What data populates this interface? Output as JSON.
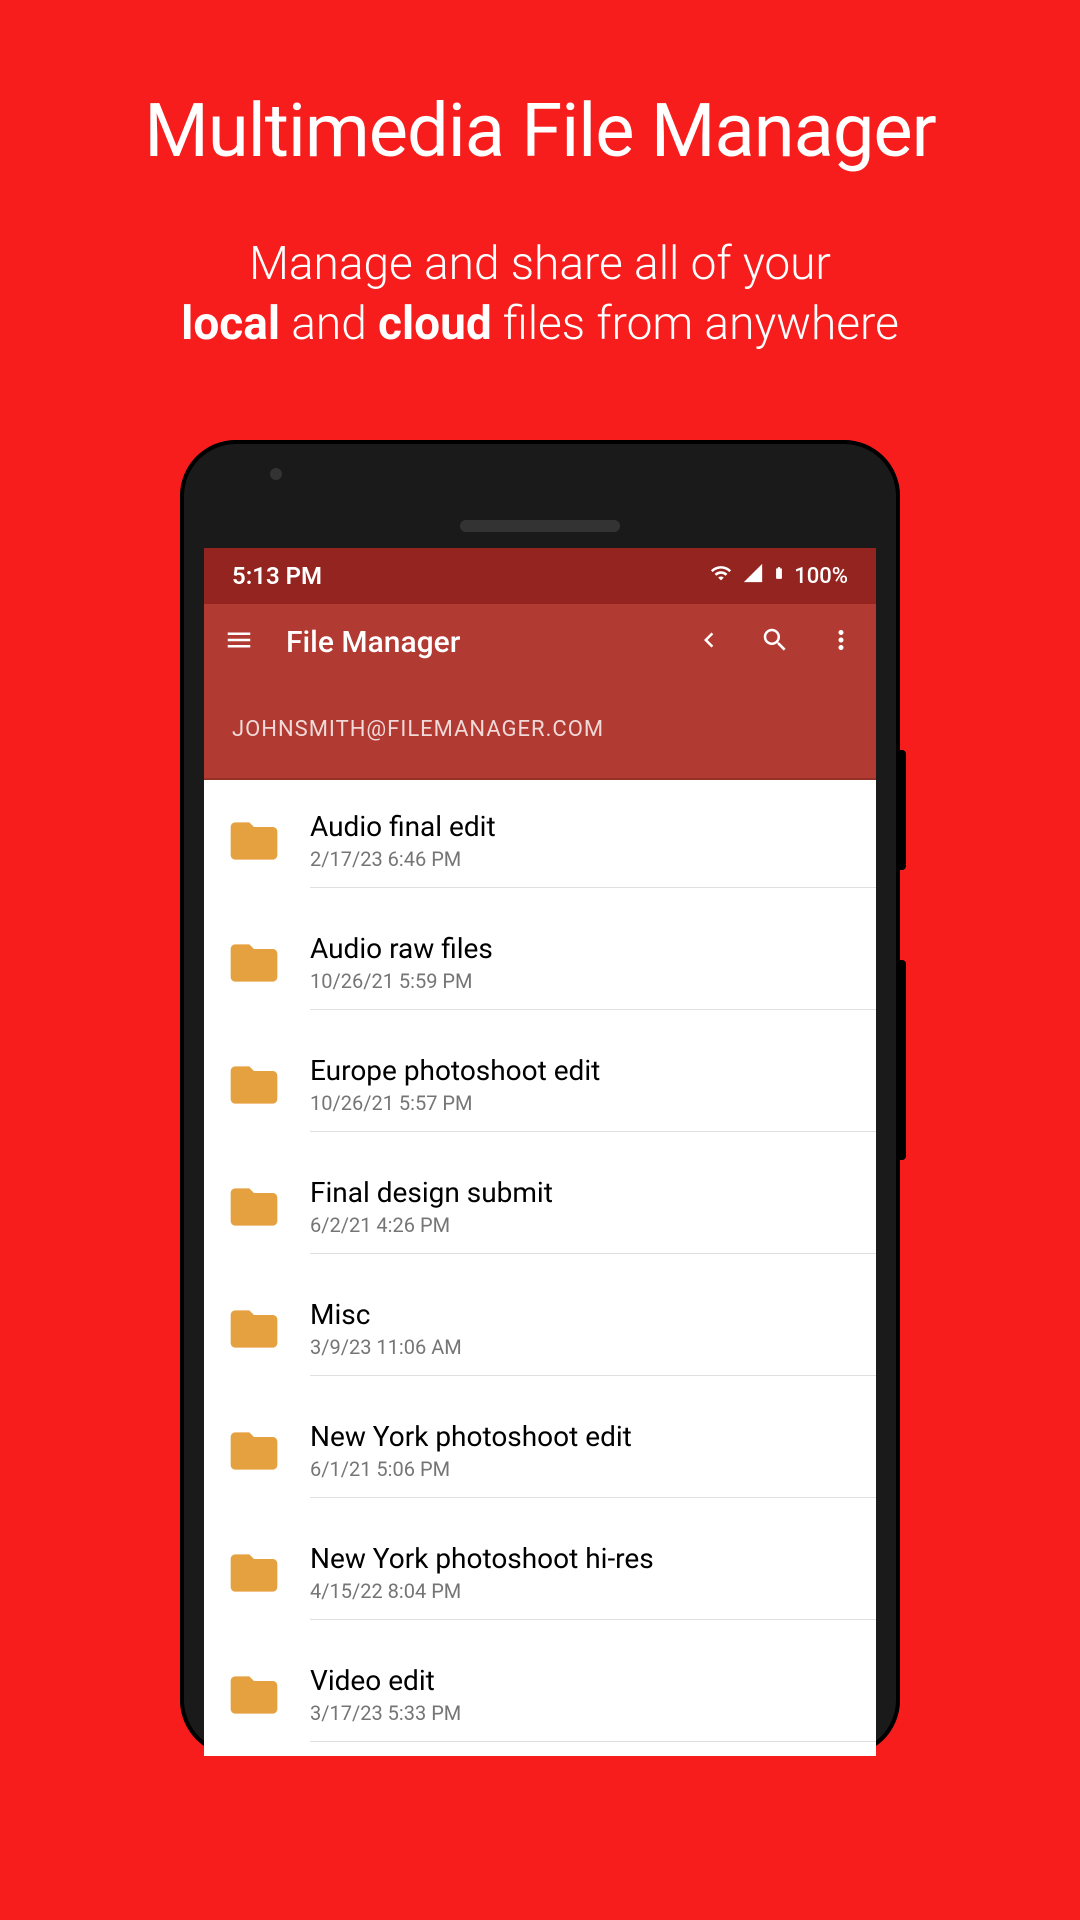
{
  "promo": {
    "title": "Multimedia File Manager",
    "subtitle_a": "Manage and share all of your",
    "subtitle_b1": "local",
    "subtitle_mid": " and ",
    "subtitle_b2": "cloud",
    "subtitle_c": " files from anywhere"
  },
  "status": {
    "time": "5:13 PM",
    "battery": "100%"
  },
  "appbar": {
    "title": "File Manager"
  },
  "breadcrumb": "JOHNSMITH@FILEMANAGER.COM",
  "files": [
    {
      "name": "Audio final edit",
      "date": "2/17/23 6:46 PM"
    },
    {
      "name": "Audio raw files",
      "date": "10/26/21 5:59 PM"
    },
    {
      "name": "Europe photoshoot edit",
      "date": "10/26/21 5:57 PM"
    },
    {
      "name": "Final design submit",
      "date": "6/2/21 4:26 PM"
    },
    {
      "name": "Misc",
      "date": "3/9/23 11:06 AM"
    },
    {
      "name": "New York photoshoot edit",
      "date": "6/1/21 5:06 PM"
    },
    {
      "name": "New York photoshoot hi-res",
      "date": "4/15/22 8:04 PM"
    },
    {
      "name": "Video edit",
      "date": "3/17/23 5:33 PM"
    }
  ]
}
